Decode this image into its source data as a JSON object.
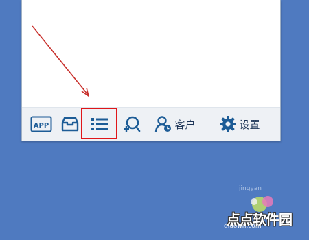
{
  "toolbar": {
    "app_label": "APP",
    "customer_label": "客户",
    "settings_label": "设置"
  },
  "watermark": {
    "brand": "点点软件园",
    "site_left": "jingyan",
    "site_right": "didown.com"
  },
  "colors": {
    "icon_blue": "#1d5c96",
    "highlight_red": "#e0161a",
    "arrow_red": "#c8302c",
    "background": "#4f7ac0"
  }
}
